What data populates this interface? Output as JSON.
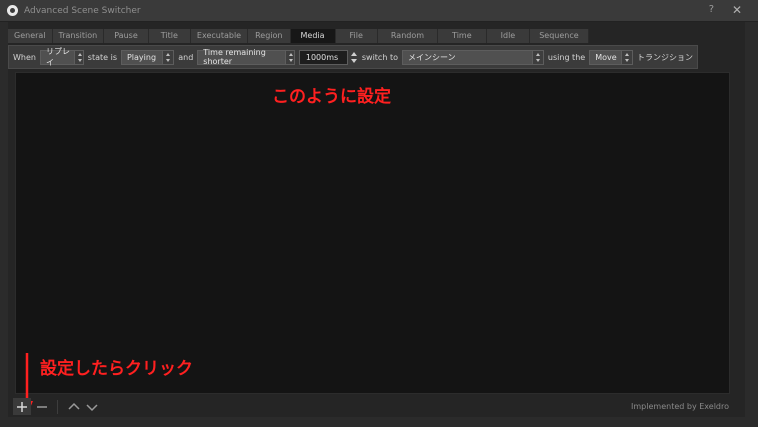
{
  "window": {
    "title": "Advanced Scene Switcher",
    "help_label": "?",
    "close_label": "✕"
  },
  "tabs": [
    {
      "label": "General",
      "active": false
    },
    {
      "label": "Transition",
      "active": false
    },
    {
      "label": "Pause",
      "active": false
    },
    {
      "label": "Title",
      "active": false
    },
    {
      "label": "Executable",
      "active": false
    },
    {
      "label": "Region",
      "active": false
    },
    {
      "label": "Media",
      "active": true
    },
    {
      "label": "File",
      "active": false
    },
    {
      "label": "Random",
      "active": false
    },
    {
      "label": "Time",
      "active": false
    },
    {
      "label": "Idle",
      "active": false
    },
    {
      "label": "Sequence",
      "active": false
    }
  ],
  "rule": {
    "when_label": "When",
    "source_value": "リプレイ",
    "state_label": "state is",
    "state_value": "Playing",
    "and_label": "and",
    "time_condition_value": "Time remaining shorter",
    "time_value": "1000ms",
    "switch_label": "switch to",
    "scene_value": "メインシーン",
    "using_label": "using the",
    "transition_value": "Move",
    "transition_suffix": "トランジション"
  },
  "annotations": {
    "top": "このように設定",
    "bottom": "設定したらクリック",
    "color": "#ff2020"
  },
  "footer": {
    "implemented_by": "Implemented by Exeldro"
  },
  "icons": {
    "add": "plus-icon",
    "remove": "minus-icon",
    "up": "chevron-up-icon",
    "down": "chevron-down-icon"
  }
}
